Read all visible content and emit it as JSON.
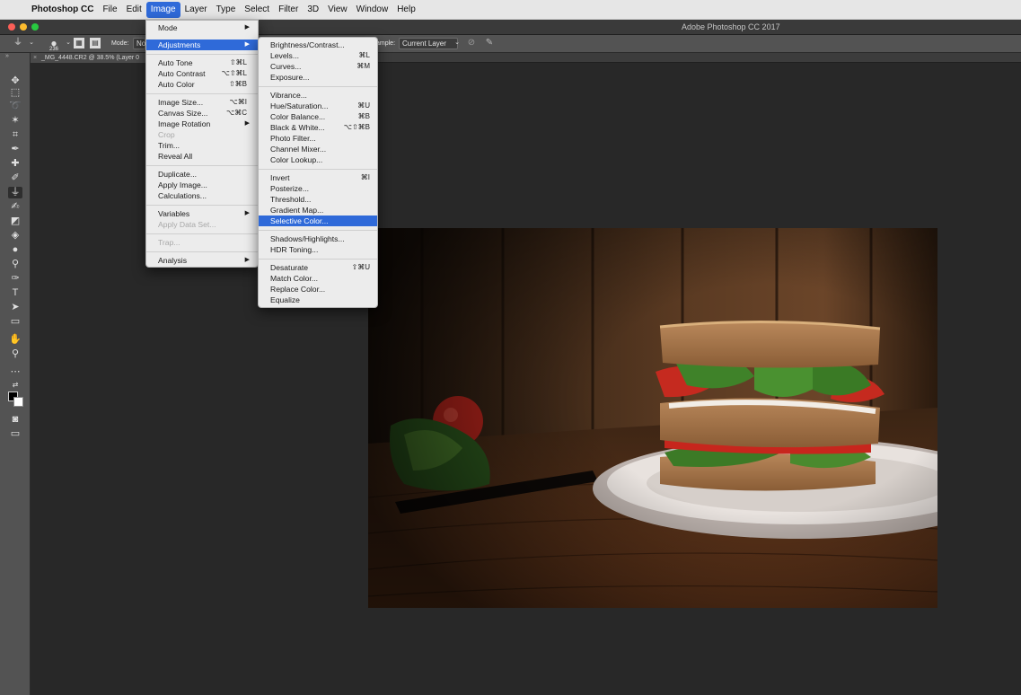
{
  "menubar": {
    "app_name": "Photoshop CC",
    "items": [
      "File",
      "Edit",
      "Image",
      "Layer",
      "Type",
      "Select",
      "Filter",
      "3D",
      "View",
      "Window",
      "Help"
    ],
    "active": "Image"
  },
  "window": {
    "title": "Adobe Photoshop CC 2017"
  },
  "options_bar": {
    "brush_size": "236",
    "mode_label": "Mode:",
    "mode_value": "Nor",
    "sample_label": "ample:",
    "sample_value": "Current Layer"
  },
  "document_tab": {
    "title": "_MG_4448.CR2 @ 38.5% (Layer 0"
  },
  "image_menu": {
    "mode": "Mode",
    "adjustments": "Adjustments",
    "auto_tone": "Auto Tone",
    "auto_tone_sc": "⇧⌘L",
    "auto_contrast": "Auto Contrast",
    "auto_contrast_sc": "⌥⇧⌘L",
    "auto_color": "Auto Color",
    "auto_color_sc": "⇧⌘B",
    "image_size": "Image Size...",
    "image_size_sc": "⌥⌘I",
    "canvas_size": "Canvas Size...",
    "canvas_size_sc": "⌥⌘C",
    "image_rotation": "Image Rotation",
    "crop": "Crop",
    "trim": "Trim...",
    "reveal_all": "Reveal All",
    "duplicate": "Duplicate...",
    "apply_image": "Apply Image...",
    "calculations": "Calculations...",
    "variables": "Variables",
    "apply_data_set": "Apply Data Set...",
    "trap": "Trap...",
    "analysis": "Analysis"
  },
  "adjustments_menu": {
    "brightness_contrast": "Brightness/Contrast...",
    "levels": "Levels...",
    "levels_sc": "⌘L",
    "curves": "Curves...",
    "curves_sc": "⌘M",
    "exposure": "Exposure...",
    "vibrance": "Vibrance...",
    "hue_saturation": "Hue/Saturation...",
    "hue_saturation_sc": "⌘U",
    "color_balance": "Color Balance...",
    "color_balance_sc": "⌘B",
    "black_white": "Black & White...",
    "black_white_sc": "⌥⇧⌘B",
    "photo_filter": "Photo Filter...",
    "channel_mixer": "Channel Mixer...",
    "color_lookup": "Color Lookup...",
    "invert": "Invert",
    "invert_sc": "⌘I",
    "posterize": "Posterize...",
    "threshold": "Threshold...",
    "gradient_map": "Gradient Map...",
    "selective_color": "Selective Color...",
    "shadows_highlights": "Shadows/Highlights...",
    "hdr_toning": "HDR Toning...",
    "desaturate": "Desaturate",
    "desaturate_sc": "⇧⌘U",
    "match_color": "Match Color...",
    "replace_color": "Replace Color...",
    "equalize": "Equalize"
  },
  "colors": {
    "menu_highlight": "#2f6ad9",
    "panel": "#535353",
    "canvas_bg": "#282828"
  }
}
